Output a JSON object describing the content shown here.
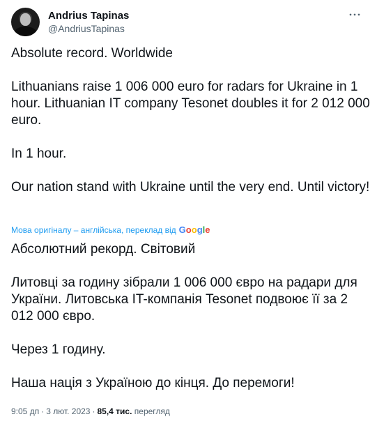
{
  "author": {
    "name": "Andrius Tapinas",
    "handle": "@AndriusTapinas"
  },
  "original": {
    "paragraphs": [
      "Absolute record. Worldwide",
      "Lithuanians raise 1 006 000 euro for radars for Ukraine in 1 hour. Lithuanian IT company Tesonet doubles it for 2 012 000 euro.",
      "In 1 hour.",
      "Our nation stand with Ukraine until the very end. Until victory!"
    ]
  },
  "translation_notice": {
    "text": "Мова оригіналу – англійська, переклад від",
    "provider": "Google"
  },
  "translated": {
    "paragraphs": [
      "Абсолютний рекорд. Світовий",
      "Литовці за годину зібрали 1 006 000 євро на радари для України. Литовська IT-компанія Tesonet подвоює її за 2 012 000 євро.",
      "Через 1 годину.",
      "Наша нація з Україною до кінця. До перемоги!"
    ]
  },
  "meta": {
    "time": "9:05 дп",
    "date": "3 лют. 2023",
    "views_count": "85,4 тис.",
    "views_label": "перегляд"
  },
  "icons": {
    "more": "more-horizontal-icon"
  },
  "colors": {
    "link": "#1d9bf0",
    "secondary_text": "#536471",
    "primary_text": "#0f1419"
  }
}
